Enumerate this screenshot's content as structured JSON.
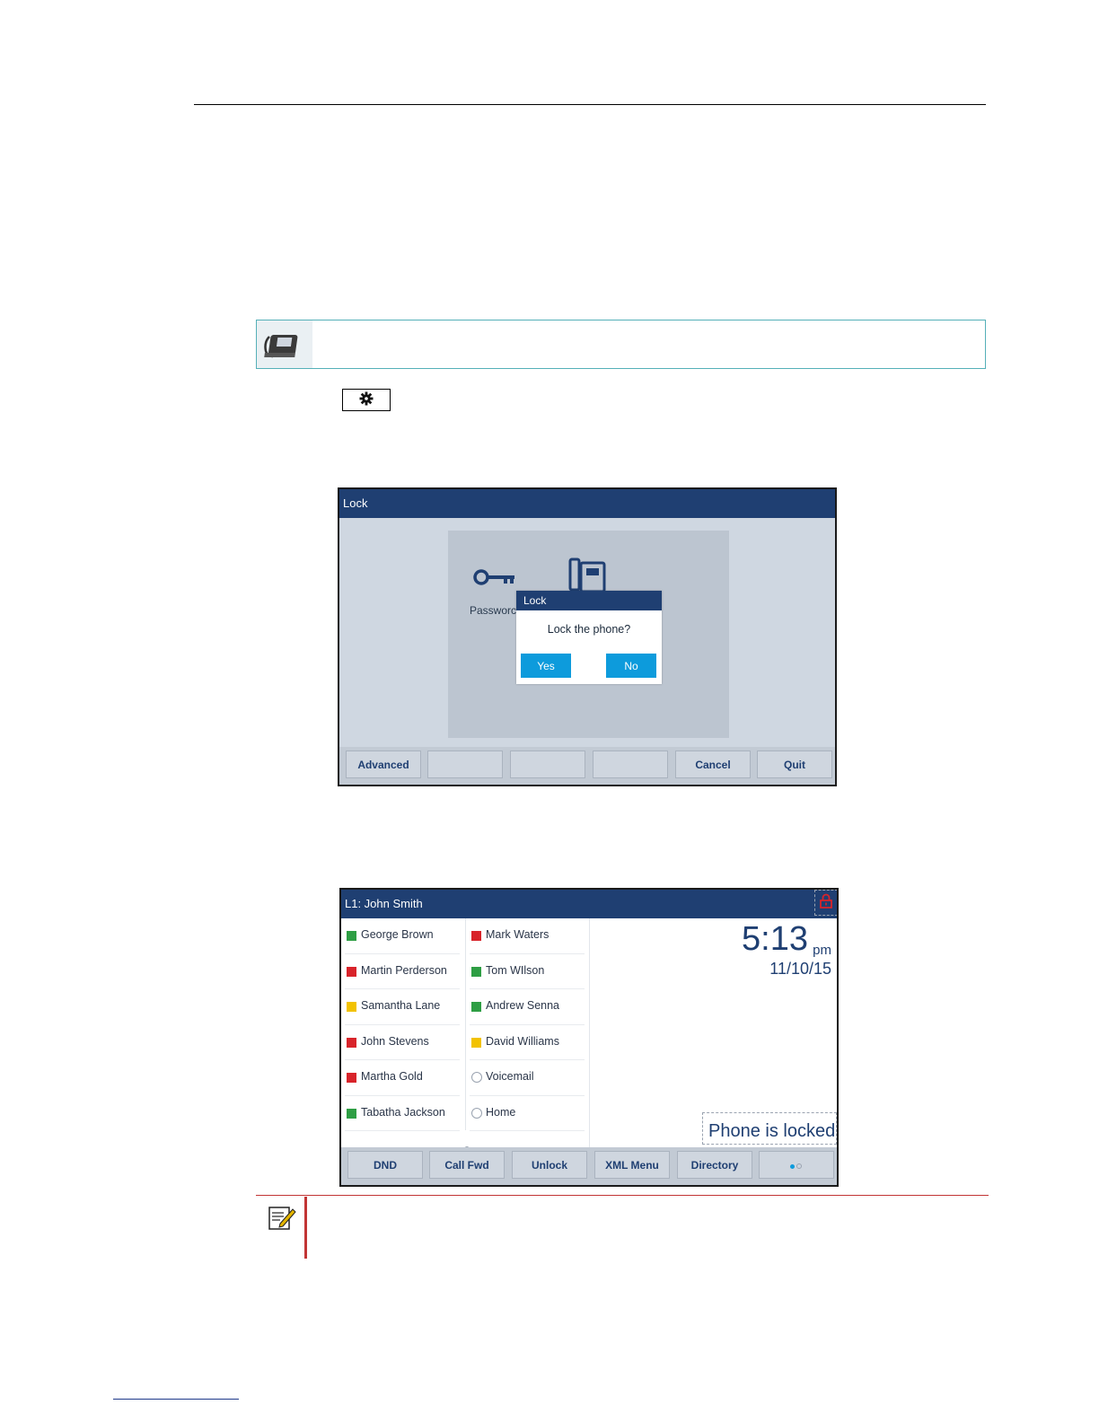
{
  "lock_screen": {
    "title": "Lock",
    "password_label": "Passworc",
    "dialog": {
      "title": "Lock",
      "message": "Lock the phone?",
      "yes": "Yes",
      "no": "No"
    },
    "softkeys": [
      "Advanced",
      "",
      "",
      "",
      "Cancel",
      "Quit"
    ]
  },
  "idle_screen": {
    "line_label": "L1: John Smith",
    "left_column": [
      {
        "name": "George Brown",
        "status": "#2e9e44"
      },
      {
        "name": "Martin Perderson",
        "status": "#d8232a"
      },
      {
        "name": "Samantha Lane",
        "status": "#f2c200"
      },
      {
        "name": "John Stevens",
        "status": "#d8232a"
      },
      {
        "name": "Martha Gold",
        "status": "#d8232a"
      },
      {
        "name": "Tabatha Jackson",
        "status": "#2e9e44"
      }
    ],
    "right_column": [
      {
        "name": "Mark Waters",
        "status": "#d8232a"
      },
      {
        "name": "Tom WIlson",
        "status": "#2e9e44"
      },
      {
        "name": "Andrew Senna",
        "status": "#2e9e44"
      },
      {
        "name": "David Williams",
        "status": "#f2c200"
      },
      {
        "name": "Voicemail",
        "status": "none"
      },
      {
        "name": "Home",
        "status": "none"
      }
    ],
    "time": "5:13",
    "ampm": "pm",
    "date": "11/10/15",
    "lock_status": "Phone is locked",
    "softkeys": [
      "DND",
      "Call Fwd",
      "Unlock",
      "XML Menu",
      "Directory"
    ]
  },
  "colors": {
    "title_bar": "#1f3f72",
    "accent_button": "#0d9bdc",
    "lock_icon": "#d8232a",
    "note_rule": "#c23535",
    "callout_border": "#55b0b8"
  }
}
